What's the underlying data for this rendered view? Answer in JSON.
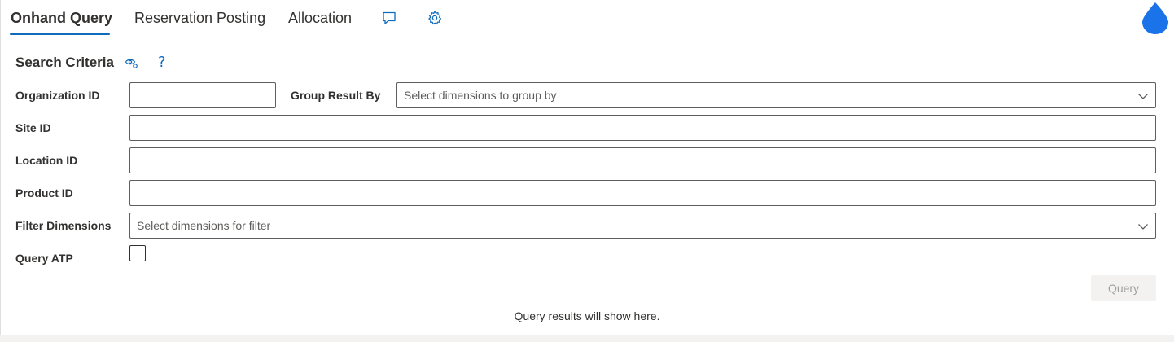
{
  "tabs": [
    {
      "label": "Onhand Query",
      "active": true
    },
    {
      "label": "Reservation Posting",
      "active": false
    },
    {
      "label": "Allocation",
      "active": false
    }
  ],
  "icons": {
    "feedback": "chat-bubble-icon",
    "settings": "gear-icon",
    "brand": "water-drop-icon",
    "view": "eye-settings-icon",
    "help": "help-question-icon",
    "chevron": "chevron-down-icon"
  },
  "colors": {
    "accent": "#0f6cbd",
    "drop": "#1a73e8"
  },
  "search": {
    "title": "Search Criteria",
    "help_glyph": "?",
    "fields": {
      "organization_id": {
        "label": "Organization ID",
        "value": ""
      },
      "group_result_by": {
        "label": "Group Result By",
        "placeholder": "Select dimensions to group by"
      },
      "site_id": {
        "label": "Site ID",
        "value": ""
      },
      "location_id": {
        "label": "Location ID",
        "value": ""
      },
      "product_id": {
        "label": "Product ID",
        "value": ""
      },
      "filter_dimensions": {
        "label": "Filter Dimensions",
        "placeholder": "Select dimensions for filter"
      },
      "query_atp": {
        "label": "Query ATP",
        "checked": false
      }
    },
    "query_button": "Query",
    "results_message": "Query results will show here."
  }
}
